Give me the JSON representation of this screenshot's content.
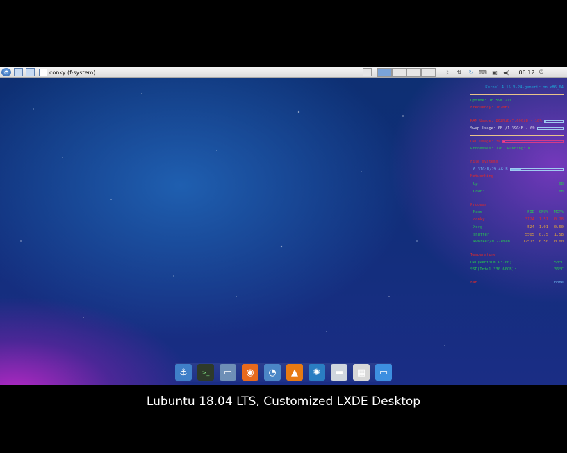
{
  "panel": {
    "window_title": "conky (f-system)",
    "clock": "06:12",
    "tray_icons": [
      "bluetooth-icon",
      "network-icon",
      "update-icon",
      "keyboard-icon",
      "display-icon",
      "volume-icon"
    ]
  },
  "conky": {
    "kernel": "Kernel 4.15.0-24-generic on x86_64",
    "uptime_label": "Uptime:",
    "uptime_value": "1h 59m 21s",
    "freq_label": "Frequency:",
    "freq_value": "707MHz",
    "ram_label": "RAM Usage:",
    "ram_value": "862MiB/7.69GiB - 10%",
    "ram_fraction": 0.1,
    "swap_label": "Swap Usage:",
    "swap_value": "0B  /1.39GiB - 0%",
    "swap_fraction": 0.0,
    "cpu_label": "CPU Usage:",
    "cpu_value": "3%",
    "cpu_fraction": 0.03,
    "processes_label": "Processes:",
    "processes_value": "170",
    "running_label": "Running:",
    "running_value": "0",
    "fs_title": "File systems",
    "fs_value": "6.31GiB/29.4GiB",
    "fs_fraction": 0.21,
    "net_title": "Networking",
    "up_label": "Up:",
    "up_value": "0B",
    "down_label": "Down:",
    "down_value": "0B",
    "process_title": "Process",
    "process_headers": [
      "Name",
      "PID",
      "CPU%",
      "MEM%"
    ],
    "processes": [
      [
        "conky",
        "3124",
        "1.51",
        "0.28"
      ],
      [
        "Xorg",
        "524",
        "1.01",
        "0.60"
      ],
      [
        "shutter",
        "5505",
        "0.75",
        "1.58"
      ],
      [
        "kworker/0:2-even",
        "12513",
        "0.50",
        "0.00"
      ]
    ],
    "temp_title": "Temperature",
    "temps": [
      {
        "label": "CPU(Pentium G3700):",
        "value": "53°C"
      },
      {
        "label": "SSD(Intel 330 60GB):",
        "value": "36°C"
      }
    ],
    "fan_label": "Fan",
    "fan_value": "none"
  },
  "dock": [
    {
      "name": "anchor-icon",
      "glyph": "⚓",
      "color": "#3f7fc8"
    },
    {
      "name": "terminal-icon",
      "glyph": ">_",
      "color": "#2e3a2a"
    },
    {
      "name": "file-manager-icon",
      "glyph": "▭",
      "color": "#6e8fb6"
    },
    {
      "name": "firefox-icon",
      "glyph": "◉",
      "color": "#e86a1c"
    },
    {
      "name": "chromium-icon",
      "glyph": "◔",
      "color": "#4b86c6"
    },
    {
      "name": "vlc-icon",
      "glyph": "▲",
      "color": "#e87a12"
    },
    {
      "name": "pinwheel-icon",
      "glyph": "✺",
      "color": "#2a7dc2"
    },
    {
      "name": "window-icon",
      "glyph": "▬",
      "color": "#cfd6de"
    },
    {
      "name": "calculator-icon",
      "glyph": "▦",
      "color": "#d7d7d7"
    },
    {
      "name": "screen-icon",
      "glyph": "▭",
      "color": "#3d8fe0"
    }
  ],
  "caption": "Lubuntu 18.04 LTS, Customized LXDE Desktop"
}
